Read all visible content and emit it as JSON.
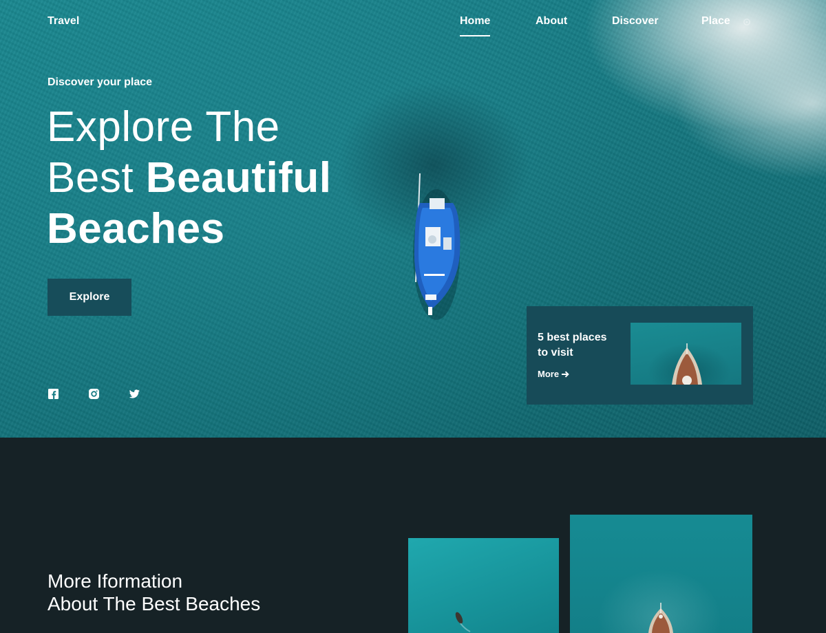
{
  "brand": {
    "logo": "Travel"
  },
  "nav": {
    "items": [
      {
        "label": "Home",
        "active": true
      },
      {
        "label": "About",
        "active": false
      },
      {
        "label": "Discover",
        "active": false
      },
      {
        "label": "Place",
        "active": false
      }
    ]
  },
  "hero": {
    "tagline": "Discover your place",
    "headline_line1": "Explore The",
    "headline_line2_light": "Best ",
    "headline_line2_bold": "Beautiful",
    "headline_line3": "Beaches",
    "cta_label": "Explore"
  },
  "social": {
    "icons": [
      "facebook-icon",
      "instagram-icon",
      "twitter-icon"
    ]
  },
  "promo_card": {
    "title_line1": "5 best places",
    "title_line2": "to visit",
    "link_label": "More"
  },
  "info": {
    "title_line1": "More Iformation",
    "title_line2": "About The Best Beaches"
  },
  "colors": {
    "ocean": "#177c85",
    "dark_bg": "#162226",
    "button_bg": "#174d5a",
    "card_bg": "#174b58"
  }
}
